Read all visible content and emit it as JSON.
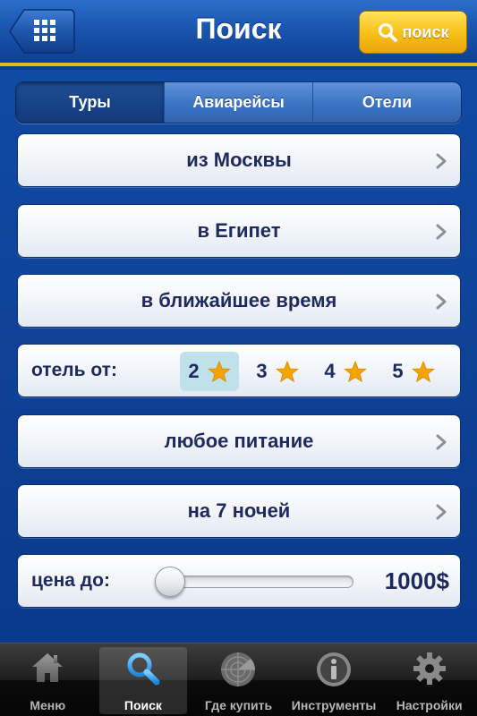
{
  "header": {
    "title": "Поиск",
    "search_button_label": "поиск"
  },
  "segments": [
    {
      "label": "Туры",
      "active": true
    },
    {
      "label": "Авиарейсы",
      "active": false
    },
    {
      "label": "Отели",
      "active": false
    }
  ],
  "rows": {
    "from": "из Москвы",
    "to": "в Египет",
    "when": "в ближайшее время",
    "hotel_label": "отель от:",
    "hotel_stars": [
      "2",
      "3",
      "4",
      "5"
    ],
    "hotel_selected": "2",
    "meal": "любое питание",
    "nights": "на 7 ночей",
    "price_label": "цена до:",
    "price_value": "1000$",
    "price_slider_fraction": 0.0
  },
  "tabbar": {
    "items": [
      {
        "label": "Меню",
        "icon": "home-icon",
        "active": false
      },
      {
        "label": "Поиск",
        "icon": "search-icon",
        "active": true
      },
      {
        "label": "Где купить",
        "icon": "radar-icon",
        "active": false
      },
      {
        "label": "Инструменты",
        "icon": "info-icon",
        "active": false
      },
      {
        "label": "Настройки",
        "icon": "gear-icon",
        "active": false
      }
    ]
  },
  "colors": {
    "accent_yellow": "#f8c21a",
    "header_blue": "#1a55b0",
    "row_text": "#1e2a5e",
    "star": "#f5a300",
    "selected_bg": "#bfe1ea"
  }
}
